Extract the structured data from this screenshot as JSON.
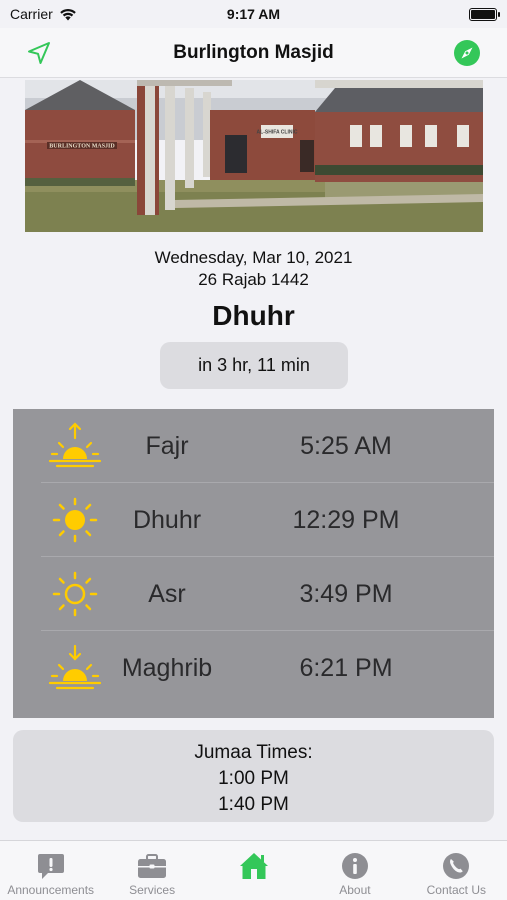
{
  "status_bar": {
    "carrier": "Carrier",
    "time": "9:17 AM"
  },
  "nav": {
    "title": "Burlington Masjid",
    "left_icon": "location-arrow-icon",
    "right_icon": "compass-icon",
    "accent": "#34c759"
  },
  "photo": {
    "sign_text": "BURLINGTON MASJID",
    "clinic_text": "AL-SHIFA CLINIC"
  },
  "date": {
    "gregorian": "Wednesday, Mar 10, 2021",
    "hijri": "26 Rajab 1442"
  },
  "next_prayer": {
    "name": "Dhuhr",
    "countdown": "in 3 hr, 11 min"
  },
  "prayers": [
    {
      "name": "Fajr",
      "time": "5:25 AM",
      "icon": "sunrise-icon"
    },
    {
      "name": "Dhuhr",
      "time": "12:29 PM",
      "icon": "sun-icon"
    },
    {
      "name": "Asr",
      "time": "3:49 PM",
      "icon": "sun-outline-icon"
    },
    {
      "name": "Maghrib",
      "time": "6:21 PM",
      "icon": "sunset-icon"
    }
  ],
  "jumaa": {
    "title": "Jumaa Times:",
    "times": [
      "1:00 PM",
      "1:40 PM"
    ]
  },
  "tabs": [
    {
      "label": "Announcements",
      "icon": "exclamation-bubble-icon"
    },
    {
      "label": "Services",
      "icon": "briefcase-icon"
    },
    {
      "label": "",
      "icon": "home-icon",
      "active": true
    },
    {
      "label": "About",
      "icon": "info-icon"
    },
    {
      "label": "Contact Us",
      "icon": "phone-icon"
    }
  ]
}
